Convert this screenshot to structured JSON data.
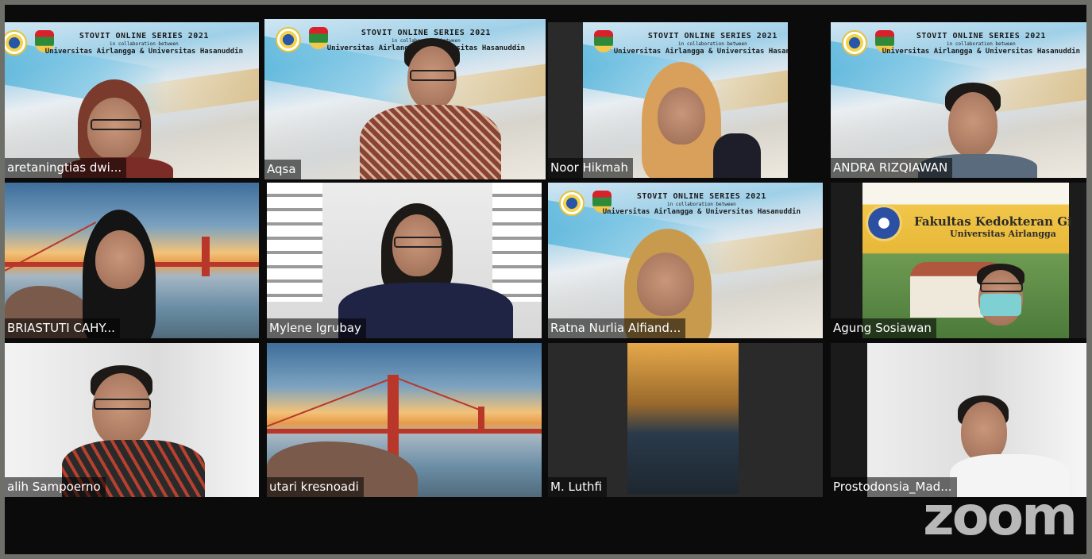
{
  "window": {
    "app": "Zoom",
    "logo_text": "zoom"
  },
  "banner": {
    "title": "STOVIT ONLINE SERIES 2021",
    "subtitle": "in collaboration between",
    "universities": "Universitas Airlangga & Universitas Hasanuddin"
  },
  "fkg_banner": {
    "title": "Fakultas Kedokteran Gi",
    "subtitle": "Universitas Airlangga"
  },
  "participants": [
    {
      "name": "aretaningtias dwi...",
      "background": "stovit"
    },
    {
      "name": "Aqsa",
      "background": "stovit",
      "active_speaker": true
    },
    {
      "name": "Noor Hikmah",
      "background": "stovit"
    },
    {
      "name": "ANDRA RIZQIAWAN",
      "background": "stovit"
    },
    {
      "name": "BRIASTUTI CAHY...",
      "background": "bridge"
    },
    {
      "name": "Mylene Igrubay",
      "background": "office"
    },
    {
      "name": "Ratna Nurlia Alfiand...",
      "background": "stovit"
    },
    {
      "name": "Agung Sosiawan",
      "background": "fkg"
    },
    {
      "name": "alih Sampoerno",
      "background": "white"
    },
    {
      "name": "utari kresnoadi",
      "background": "bridge"
    },
    {
      "name": "M. Luthfi",
      "background": "dark"
    },
    {
      "name": "Prostodonsia_Mad...",
      "background": "white"
    }
  ],
  "colors": {
    "active_outline": "#8fd14f",
    "stage": "#0b0b0b"
  }
}
